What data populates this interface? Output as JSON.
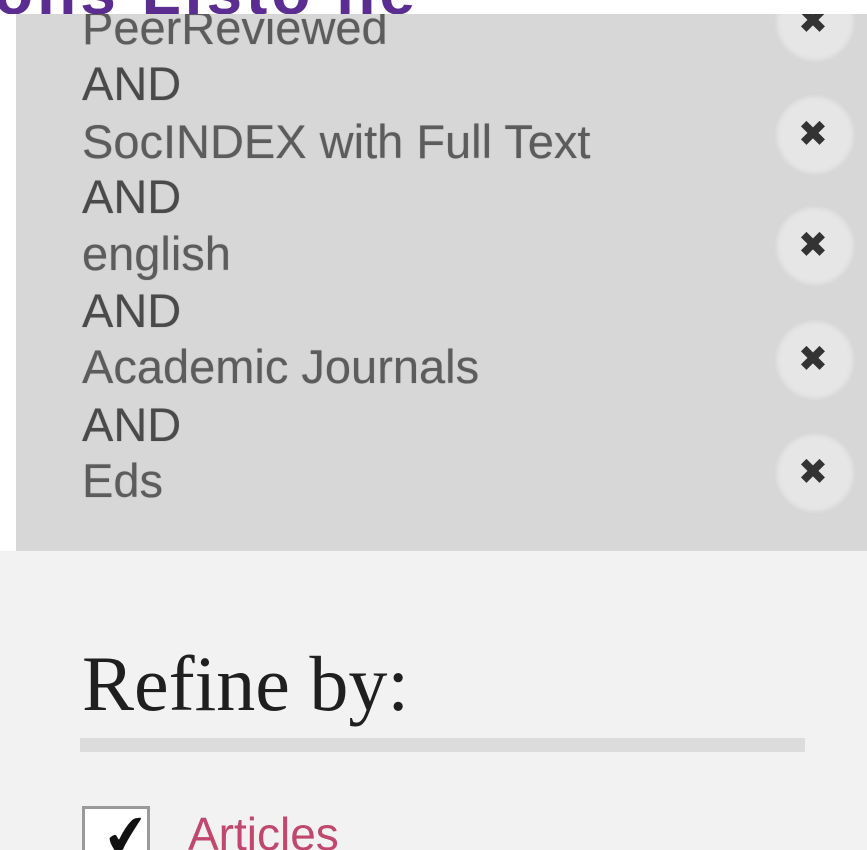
{
  "header": {
    "cut_text": "ons   Listo  ne"
  },
  "filters": {
    "items": [
      {
        "label": "PeerReviewed",
        "remove_icon": "close-icon"
      },
      {
        "label": "SocINDEX with Full Text",
        "remove_icon": "close-icon"
      },
      {
        "label": "english",
        "remove_icon": "close-icon"
      },
      {
        "label": "Academic Journals",
        "remove_icon": "close-icon"
      },
      {
        "label": "Eds",
        "remove_icon": "close-icon"
      }
    ],
    "connector": "AND",
    "remove_glyph": "✖"
  },
  "refine": {
    "title": "Refine by:",
    "facets": [
      {
        "label": "Articles",
        "checked": true,
        "check_glyph": "✔"
      }
    ]
  },
  "colors": {
    "panel_bg": "#d7d7d7",
    "lower_bg": "#f2f2f2",
    "facet_link": "#c0476e",
    "header_accent": "#5b2d91"
  }
}
